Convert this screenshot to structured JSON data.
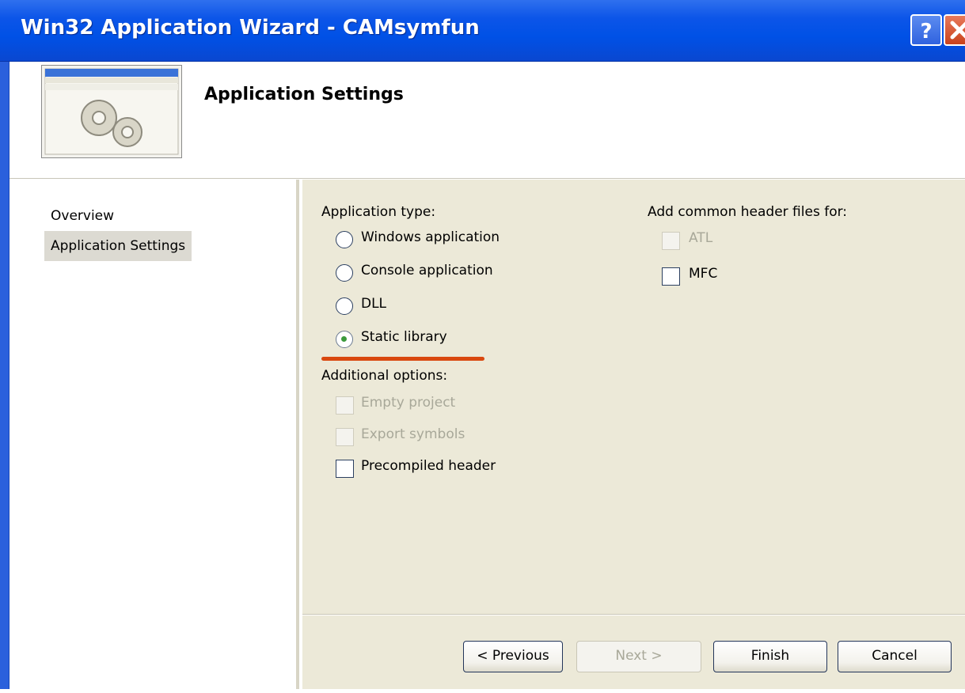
{
  "window": {
    "title": "Win32 Application Wizard - CAMsymfun"
  },
  "header": {
    "title": "Application Settings"
  },
  "nav": {
    "items": [
      {
        "label": "Overview"
      },
      {
        "label": "Application Settings"
      }
    ]
  },
  "application_type": {
    "label": "Application type:",
    "options": [
      {
        "label": "Windows application",
        "selected": false
      },
      {
        "label": "Console application",
        "selected": false
      },
      {
        "label": "DLL",
        "selected": false
      },
      {
        "label": "Static library",
        "selected": true
      }
    ]
  },
  "additional_options": {
    "label": "Additional options:",
    "options": [
      {
        "label": "Empty project",
        "enabled": false
      },
      {
        "label": "Export symbols",
        "enabled": false
      },
      {
        "label": "Precompiled header",
        "enabled": true
      }
    ]
  },
  "common_headers": {
    "label": "Add common header files for:",
    "options": [
      {
        "label": "ATL",
        "enabled": false
      },
      {
        "label": "MFC",
        "enabled": true
      }
    ]
  },
  "buttons": {
    "previous": "< Previous",
    "next": "Next >",
    "finish": "Finish",
    "cancel": "Cancel"
  },
  "colors": {
    "titlebar": "#0051e6",
    "highlight_mark": "#d9480f",
    "dialog_background": "#ece9d8"
  }
}
